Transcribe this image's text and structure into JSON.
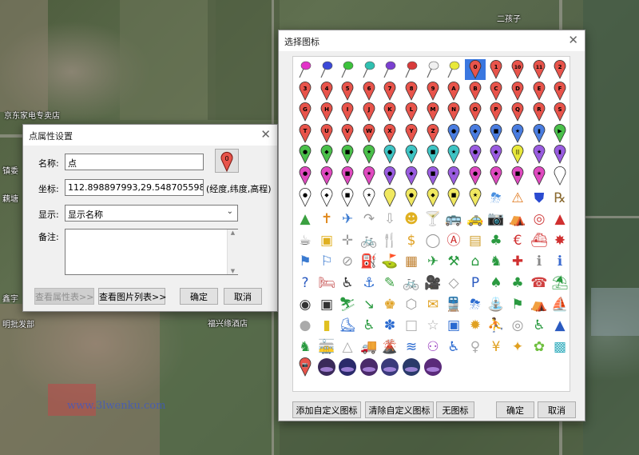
{
  "map": {
    "labels": [
      "京东家电专卖店",
      "二孩子",
      "福兴缘酒店",
      "明批发部",
      "镇委",
      "鑫宇",
      "藕塘"
    ],
    "watermark": "www.3lwenku.com"
  },
  "point_dialog": {
    "title": "点属性设置",
    "name_label": "名称:",
    "name_value": "点",
    "coord_label": "坐标:",
    "coord_value": "112.898897993,29.548705598,31.516",
    "coord_hint": "(经度,纬度,高程)",
    "display_label": "显示:",
    "display_value": "显示名称",
    "note_label": "备注:",
    "note_value": "",
    "icon_button_number": "0",
    "btn_attr": "查看属性表>>",
    "btn_pics": "查看图片列表>>",
    "btn_ok": "确定",
    "btn_cancel": "取消"
  },
  "icon_dialog": {
    "title": "选择图标",
    "btn_add": "添加自定义图标",
    "btn_clear": "清除自定义图标",
    "btn_none": "无图标",
    "btn_ok": "确定",
    "btn_cancel": "取消",
    "rows": [
      [
        {
          "t": "pushpin",
          "c": "#e233c8"
        },
        {
          "t": "pushpin",
          "c": "#3b49d8"
        },
        {
          "t": "pushpin",
          "c": "#3cc23c"
        },
        {
          "t": "pushpin",
          "c": "#2fc0b0"
        },
        {
          "t": "pushpin",
          "c": "#7a3fd0"
        },
        {
          "t": "pushpin",
          "c": "#d83b3b"
        },
        {
          "t": "pushpin",
          "c": "#f0f0f0"
        },
        {
          "t": "pushpin",
          "c": "#e8e83a"
        },
        {
          "t": "pin",
          "c": "#e8544b",
          "s": "0",
          "sel": true
        },
        {
          "t": "pin",
          "c": "#e8544b",
          "s": "1"
        },
        {
          "t": "pin",
          "c": "#e8544b",
          "s": "10"
        },
        {
          "t": "pin",
          "c": "#e8544b",
          "s": "11"
        },
        {
          "t": "pin",
          "c": "#e8544b",
          "s": "2"
        }
      ],
      [
        {
          "t": "pin",
          "c": "#e8544b",
          "s": "3"
        },
        {
          "t": "pin",
          "c": "#e8544b",
          "s": "4"
        },
        {
          "t": "pin",
          "c": "#e8544b",
          "s": "5"
        },
        {
          "t": "pin",
          "c": "#e8544b",
          "s": "6"
        },
        {
          "t": "pin",
          "c": "#e8544b",
          "s": "7"
        },
        {
          "t": "pin",
          "c": "#e8544b",
          "s": "8"
        },
        {
          "t": "pin",
          "c": "#e8544b",
          "s": "9"
        },
        {
          "t": "pin",
          "c": "#e8544b",
          "s": "A"
        },
        {
          "t": "pin",
          "c": "#e8544b",
          "s": "B"
        },
        {
          "t": "pin",
          "c": "#e8544b",
          "s": "C"
        },
        {
          "t": "pin",
          "c": "#e8544b",
          "s": "D"
        },
        {
          "t": "pin",
          "c": "#e8544b",
          "s": "E"
        },
        {
          "t": "pin",
          "c": "#e8544b",
          "s": "F"
        }
      ],
      [
        {
          "t": "pin",
          "c": "#e8544b",
          "s": "G"
        },
        {
          "t": "pin",
          "c": "#e8544b",
          "s": "H"
        },
        {
          "t": "pin",
          "c": "#e8544b",
          "s": "I"
        },
        {
          "t": "pin",
          "c": "#e8544b",
          "s": "J"
        },
        {
          "t": "pin",
          "c": "#e8544b",
          "s": "K"
        },
        {
          "t": "pin",
          "c": "#e8544b",
          "s": "L"
        },
        {
          "t": "pin",
          "c": "#e8544b",
          "s": "M"
        },
        {
          "t": "pin",
          "c": "#e8544b",
          "s": "N"
        },
        {
          "t": "pin",
          "c": "#e8544b",
          "s": "O"
        },
        {
          "t": "pin",
          "c": "#e8544b",
          "s": "P"
        },
        {
          "t": "pin",
          "c": "#e8544b",
          "s": "Q"
        },
        {
          "t": "pin",
          "c": "#e8544b",
          "s": "R"
        },
        {
          "t": "pin",
          "c": "#e8544b",
          "s": "S"
        }
      ],
      [
        {
          "t": "pin",
          "c": "#e8544b",
          "s": "T"
        },
        {
          "t": "pin",
          "c": "#e8544b",
          "s": "U"
        },
        {
          "t": "pin",
          "c": "#e8544b",
          "s": "V"
        },
        {
          "t": "pin",
          "c": "#e8544b",
          "s": "W"
        },
        {
          "t": "pin",
          "c": "#e8544b",
          "s": "X"
        },
        {
          "t": "pin",
          "c": "#e8544b",
          "s": "Y"
        },
        {
          "t": "pin",
          "c": "#e8544b",
          "s": "Z"
        },
        {
          "t": "pin",
          "c": "#4a7de0",
          "s": "●"
        },
        {
          "t": "pin",
          "c": "#4a7de0",
          "s": "◆"
        },
        {
          "t": "pin",
          "c": "#4a7de0",
          "s": "■"
        },
        {
          "t": "pin",
          "c": "#4a7de0",
          "s": "★"
        },
        {
          "t": "pin",
          "c": "#4a7de0",
          "s": "▮"
        },
        {
          "t": "pin",
          "c": "#4ac04a",
          "s": "▶"
        }
      ],
      [
        {
          "t": "pin",
          "c": "#4ac04a",
          "s": "●"
        },
        {
          "t": "pin",
          "c": "#4ac04a",
          "s": "◆"
        },
        {
          "t": "pin",
          "c": "#4ac04a",
          "s": "■"
        },
        {
          "t": "pin",
          "c": "#4ac04a",
          "s": "★"
        },
        {
          "t": "pin",
          "c": "#3ec4c4",
          "s": "●"
        },
        {
          "t": "pin",
          "c": "#3ec4c4",
          "s": "◆"
        },
        {
          "t": "pin",
          "c": "#3ec4c4",
          "s": "■"
        },
        {
          "t": "pin",
          "c": "#3ec4c4",
          "s": "★"
        },
        {
          "t": "pin",
          "c": "#9a5ce0",
          "s": "●"
        },
        {
          "t": "pin",
          "c": "#9a5ce0",
          "s": "◆"
        },
        {
          "t": "pin",
          "c": "#e8e83a",
          "s": "||"
        },
        {
          "t": "pin",
          "c": "#9a5ce0",
          "s": "★"
        },
        {
          "t": "pin",
          "c": "#9a5ce0",
          "s": "▮"
        }
      ],
      [
        {
          "t": "pin",
          "c": "#e04ac0",
          "s": "●"
        },
        {
          "t": "pin",
          "c": "#e04ac0",
          "s": "◆"
        },
        {
          "t": "pin",
          "c": "#e04ac0",
          "s": "■"
        },
        {
          "t": "pin",
          "c": "#e04ac0",
          "s": "★"
        },
        {
          "t": "pin",
          "c": "#9a5ce0",
          "s": "●"
        },
        {
          "t": "pin",
          "c": "#9a5ce0",
          "s": "◆"
        },
        {
          "t": "pin",
          "c": "#9a5ce0",
          "s": "■"
        },
        {
          "t": "pin",
          "c": "#9a5ce0",
          "s": "★"
        },
        {
          "t": "pin",
          "c": "#e04ac0",
          "s": "●"
        },
        {
          "t": "pin",
          "c": "#e04ac0",
          "s": "◆"
        },
        {
          "t": "pin",
          "c": "#e04ac0",
          "s": "■"
        },
        {
          "t": "pin",
          "c": "#e04ac0",
          "s": "★"
        },
        {
          "t": "pin",
          "c": "#ffffff",
          "s": ""
        }
      ],
      [
        {
          "t": "pin",
          "c": "#ffffff",
          "s": "●"
        },
        {
          "t": "pin",
          "c": "#ffffff",
          "s": "◆"
        },
        {
          "t": "pin",
          "c": "#ffffff",
          "s": "■"
        },
        {
          "t": "pin",
          "c": "#ffffff",
          "s": "★"
        },
        {
          "t": "pin",
          "c": "#f0e860",
          "s": ""
        },
        {
          "t": "pin",
          "c": "#f0e860",
          "s": "●"
        },
        {
          "t": "pin",
          "c": "#f0e860",
          "s": "◆"
        },
        {
          "t": "pin",
          "c": "#f0e860",
          "s": "■"
        },
        {
          "t": "pin",
          "c": "#f0e860",
          "s": "★"
        },
        {
          "t": "glyph",
          "g": "⛈",
          "c": "#4a90e0"
        },
        {
          "t": "glyph",
          "g": "⚠",
          "c": "#e07a20"
        },
        {
          "t": "glyph",
          "g": "⛊",
          "c": "#2a4ad0"
        },
        {
          "t": "glyph",
          "g": "℞",
          "c": "#8a6a30"
        }
      ],
      [
        {
          "t": "glyph",
          "g": "▲",
          "c": "#3aa040"
        },
        {
          "t": "glyph",
          "g": "✝",
          "c": "#e08a20"
        },
        {
          "t": "glyph",
          "g": "✈",
          "c": "#3a7ad0"
        },
        {
          "t": "glyph",
          "g": "↷",
          "c": "#999999"
        },
        {
          "t": "glyph",
          "g": "⇩",
          "c": "#aaaaaa"
        },
        {
          "t": "glyph",
          "g": "☻",
          "c": "#e0b020"
        },
        {
          "t": "glyph",
          "g": "🍸",
          "c": "#aaaaaa"
        },
        {
          "t": "glyph",
          "g": "🚌",
          "c": "#3a6ad0"
        },
        {
          "t": "glyph",
          "g": "🚕",
          "c": "#3a7ad0"
        },
        {
          "t": "glyph",
          "g": "📷",
          "c": "#d050c0"
        },
        {
          "t": "glyph",
          "g": "⛺",
          "c": "#3aa040"
        },
        {
          "t": "glyph",
          "g": "◎",
          "c": "#d04040"
        },
        {
          "t": "glyph",
          "g": "▲",
          "c": "#d03030"
        }
      ],
      [
        {
          "t": "glyph",
          "g": "☕",
          "c": "#666666"
        },
        {
          "t": "glyph",
          "g": "▣",
          "c": "#e0b020"
        },
        {
          "t": "glyph",
          "g": "✛",
          "c": "#999999"
        },
        {
          "t": "glyph",
          "g": "🚲",
          "c": "#3aa040"
        },
        {
          "t": "glyph",
          "g": "🍴",
          "c": "#333333"
        },
        {
          "t": "glyph",
          "g": "$",
          "c": "#e0a020"
        },
        {
          "t": "glyph",
          "g": "◯",
          "c": "#999999"
        },
        {
          "t": "glyph",
          "g": "Ⓐ",
          "c": "#d03030"
        },
        {
          "t": "glyph",
          "g": "▤",
          "c": "#d0a030"
        },
        {
          "t": "glyph",
          "g": "♣",
          "c": "#2a9a40"
        },
        {
          "t": "glyph",
          "g": "€",
          "c": "#d03030"
        },
        {
          "t": "glyph",
          "g": "⛴",
          "c": "#d03030"
        },
        {
          "t": "glyph",
          "g": "✸",
          "c": "#d03030"
        }
      ],
      [
        {
          "t": "glyph",
          "g": "⚑",
          "c": "#3a7ad0"
        },
        {
          "t": "glyph",
          "g": "⚐",
          "c": "#3a7ad0"
        },
        {
          "t": "glyph",
          "g": "⊘",
          "c": "#999999"
        },
        {
          "t": "glyph",
          "g": "⛽",
          "c": "#3aa040"
        },
        {
          "t": "glyph",
          "g": "⛳",
          "c": "#3aa040"
        },
        {
          "t": "glyph",
          "g": "▦",
          "c": "#c08030"
        },
        {
          "t": "glyph",
          "g": "✈",
          "c": "#2a9a40"
        },
        {
          "t": "glyph",
          "g": "⚒",
          "c": "#2a9a40"
        },
        {
          "t": "glyph",
          "g": "⌂",
          "c": "#2a9a40"
        },
        {
          "t": "glyph",
          "g": "♞",
          "c": "#2a9a40"
        },
        {
          "t": "glyph",
          "g": "✚",
          "c": "#d03030"
        },
        {
          "t": "glyph",
          "g": "ℹ",
          "c": "#888888"
        },
        {
          "t": "glyph",
          "g": "ℹ",
          "c": "#3a6ad0"
        }
      ],
      [
        {
          "t": "glyph",
          "g": "?",
          "c": "#2a5ac0"
        },
        {
          "t": "glyph",
          "g": "🛏",
          "c": "#c04040"
        },
        {
          "t": "glyph",
          "g": "♿",
          "c": "#333333"
        },
        {
          "t": "glyph",
          "g": "⚓",
          "c": "#2a6ad0"
        },
        {
          "t": "glyph",
          "g": "✎",
          "c": "#3aa040"
        },
        {
          "t": "glyph",
          "g": "🚲",
          "c": "#3aa040"
        },
        {
          "t": "glyph",
          "g": "🎥",
          "c": "#c0a030"
        },
        {
          "t": "glyph",
          "g": "◇",
          "c": "#999999"
        },
        {
          "t": "glyph",
          "g": "P",
          "c": "#2a5ac0"
        },
        {
          "t": "glyph",
          "g": "♠",
          "c": "#2a9a40"
        },
        {
          "t": "glyph",
          "g": "♣",
          "c": "#2a9a40"
        },
        {
          "t": "glyph",
          "g": "☎",
          "c": "#d04040"
        },
        {
          "t": "glyph",
          "g": "⛱",
          "c": "#2a9a40"
        }
      ],
      [
        {
          "t": "glyph",
          "g": "◉",
          "c": "#333333"
        },
        {
          "t": "glyph",
          "g": "▣",
          "c": "#333333"
        },
        {
          "t": "glyph",
          "g": "⛷",
          "c": "#2a9a40"
        },
        {
          "t": "glyph",
          "g": "↘",
          "c": "#2a9a40"
        },
        {
          "t": "glyph",
          "g": "♚",
          "c": "#e0a020"
        },
        {
          "t": "glyph",
          "g": "⬡",
          "c": "#999999"
        },
        {
          "t": "glyph",
          "g": "✉",
          "c": "#e0a020"
        },
        {
          "t": "glyph",
          "g": "🚆",
          "c": "#2a6ad0"
        },
        {
          "t": "glyph",
          "g": "⛈",
          "c": "#2a6ad0"
        },
        {
          "t": "glyph",
          "g": "⛲",
          "c": "#2a9a40"
        },
        {
          "t": "glyph",
          "g": "⚑",
          "c": "#2a9a40"
        },
        {
          "t": "glyph",
          "g": "⛺",
          "c": "#2a6ad0"
        },
        {
          "t": "glyph",
          "g": "⛵",
          "c": "#2a6ad0"
        }
      ],
      [
        {
          "t": "glyph",
          "g": "●",
          "c": "#aaaaaa"
        },
        {
          "t": "glyph",
          "g": "▮",
          "c": "#e0c020"
        },
        {
          "t": "glyph",
          "g": "⛸",
          "c": "#2a6ad0"
        },
        {
          "t": "glyph",
          "g": "♿",
          "c": "#2a9a40"
        },
        {
          "t": "glyph",
          "g": "✽",
          "c": "#2a6ad0"
        },
        {
          "t": "glyph",
          "g": "□",
          "c": "#aaaaaa"
        },
        {
          "t": "glyph",
          "g": "☆",
          "c": "#aaaaaa"
        },
        {
          "t": "glyph",
          "g": "▣",
          "c": "#2a6ad0"
        },
        {
          "t": "glyph",
          "g": "✹",
          "c": "#e0a020"
        },
        {
          "t": "glyph",
          "g": "⛹",
          "c": "#2a6ad0"
        },
        {
          "t": "glyph",
          "g": "◎",
          "c": "#999999"
        },
        {
          "t": "glyph",
          "g": "♿",
          "c": "#2a9a40"
        },
        {
          "t": "glyph",
          "g": "▲",
          "c": "#2a5ac0"
        }
      ],
      [
        {
          "t": "glyph",
          "g": "♞",
          "c": "#2a9a40"
        },
        {
          "t": "glyph",
          "g": "🚋",
          "c": "#2a6ad0"
        },
        {
          "t": "glyph",
          "g": "△",
          "c": "#aaaaaa"
        },
        {
          "t": "glyph",
          "g": "🚚",
          "c": "#2a6ad0"
        },
        {
          "t": "glyph",
          "g": "🌋",
          "c": "#d04040"
        },
        {
          "t": "glyph",
          "g": "≋",
          "c": "#2a6ad0"
        },
        {
          "t": "glyph",
          "g": "⚇",
          "c": "#9a40c0"
        },
        {
          "t": "glyph",
          "g": "♿",
          "c": "#2a6ad0"
        },
        {
          "t": "glyph",
          "g": "♀",
          "c": "#aaaaaa"
        },
        {
          "t": "glyph",
          "g": "¥",
          "c": "#e0a020"
        },
        {
          "t": "glyph",
          "g": "✦",
          "c": "#e0a020"
        },
        {
          "t": "glyph",
          "g": "✿",
          "c": "#70c040"
        },
        {
          "t": "glyph",
          "g": "▩",
          "c": "#3ab0c0"
        }
      ],
      [
        {
          "t": "pin",
          "c": "#e8544b",
          "s": "📷"
        },
        {
          "t": "photo",
          "c": "#3a2a5a"
        },
        {
          "t": "photo",
          "c": "#2a2a6a"
        },
        {
          "t": "photo",
          "c": "#4a2a6a"
        },
        {
          "t": "photo",
          "c": "#3a3a7a"
        },
        {
          "t": "photo",
          "c": "#2a3a6a"
        },
        {
          "t": "photo",
          "c": "#5a2a7a"
        }
      ]
    ]
  }
}
